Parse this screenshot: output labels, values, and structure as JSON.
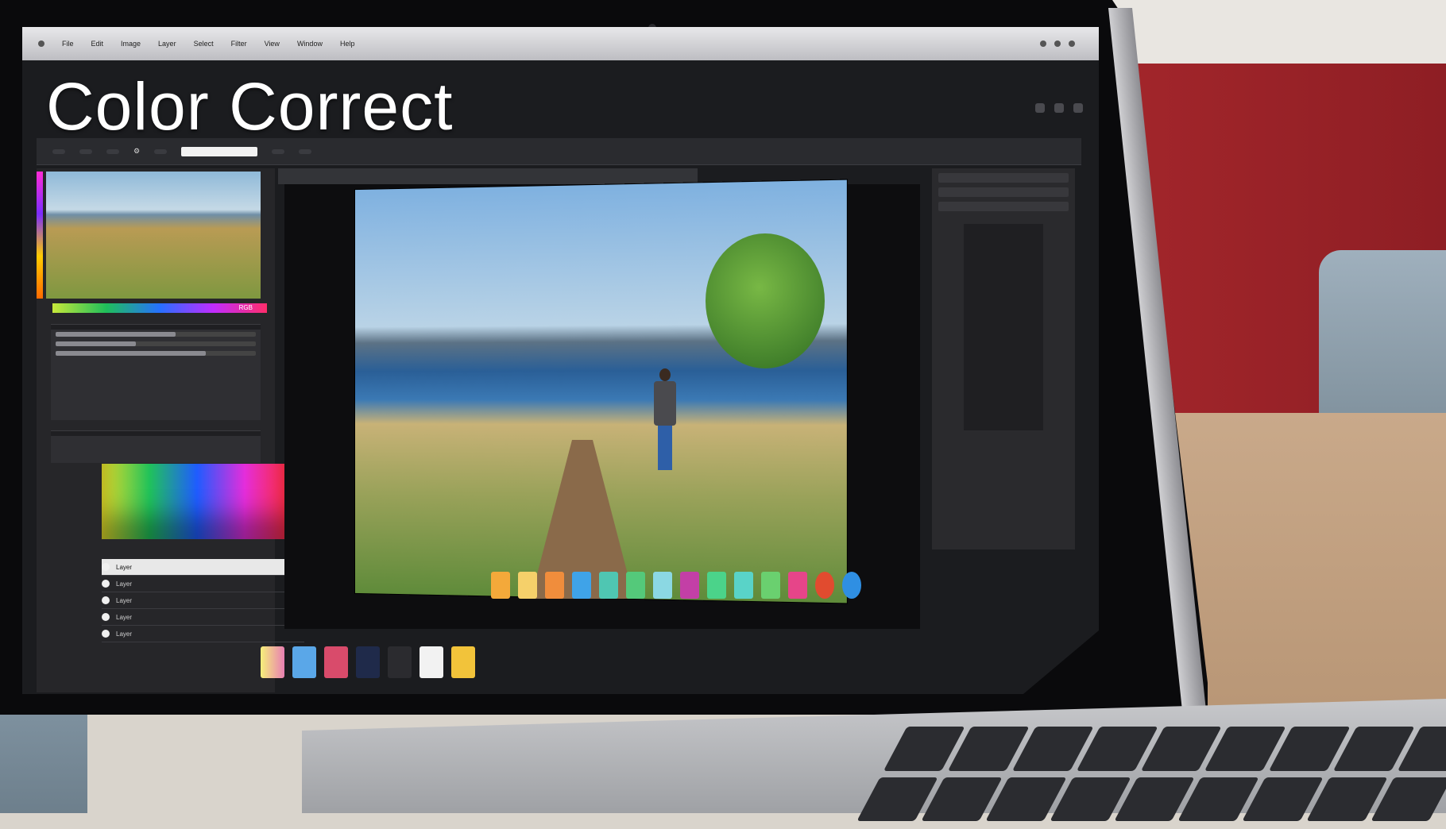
{
  "overlay": {
    "title": "Color Correct"
  },
  "menubar": {
    "items": [
      "File",
      "Edit",
      "Image",
      "Layer",
      "Select",
      "Filter",
      "View",
      "Window",
      "Help"
    ]
  },
  "left_panel": {
    "color_mode_label": "RGB",
    "layers": [
      {
        "label": "Layer"
      },
      {
        "label": "Layer"
      },
      {
        "label": "Layer"
      },
      {
        "label": "Layer"
      },
      {
        "label": "Layer"
      }
    ]
  },
  "colors": {
    "wall": "#a3262b",
    "ui_dark": "#1b1c1f",
    "panel": "#262629"
  },
  "icons": [
    "search-icon",
    "gear-icon",
    "layer-visibility-icon"
  ]
}
